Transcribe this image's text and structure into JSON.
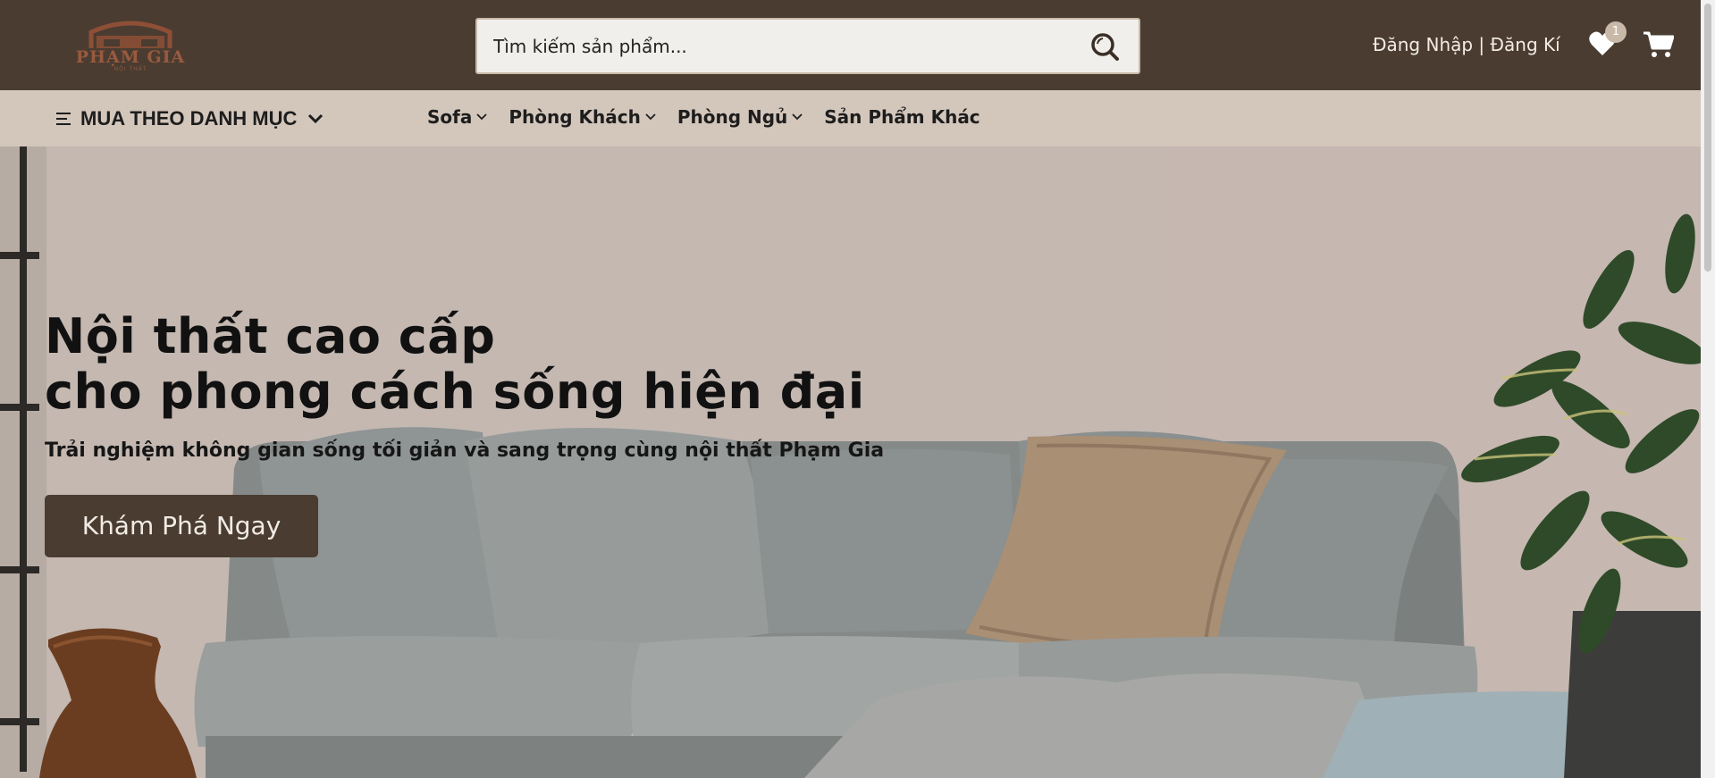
{
  "header": {
    "logo_text": "PHẠM GIA",
    "logo_sub": "NỘI THẤT",
    "search_placeholder": "Tìm kiếm sản phẩm...",
    "login": "Đăng Nhập",
    "separator": " | ",
    "register": "Đăng Kí",
    "wishlist_count": "1",
    "icons": [
      "search-icon",
      "heart-icon",
      "cart-icon"
    ]
  },
  "nav": {
    "category_menu": "MUA THEO DANH MỤC",
    "items": [
      {
        "label": "Sofa"
      },
      {
        "label": "Phòng Khách"
      },
      {
        "label": "Phòng Ngủ"
      },
      {
        "label": "Sản Phẩm Khác"
      }
    ]
  },
  "hero": {
    "title_line1": "Nội thất cao cấp",
    "title_line2": "cho phong cách sống hiện đại",
    "subtitle": "Trải nghiệm không gian sống tối giản và sang trọng cùng nội thất Phạm Gia",
    "cta": "Khám Phá Ngay"
  },
  "colors": {
    "header_bg": "#4a3c31",
    "nav_bg": "#d3c6bb",
    "cta_bg": "#4a3c31"
  }
}
